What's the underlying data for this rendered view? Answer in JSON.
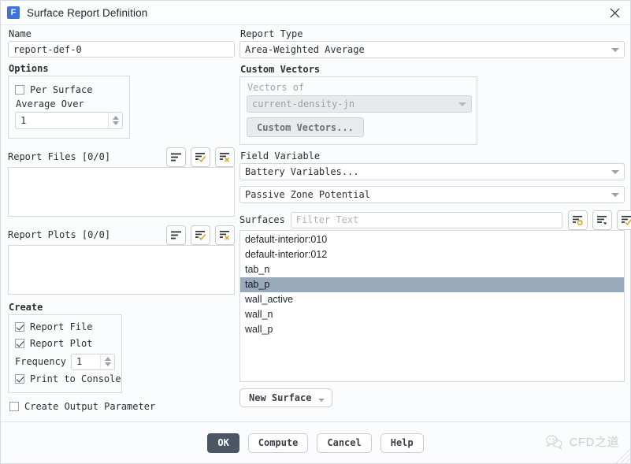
{
  "window": {
    "title": "Surface Report Definition",
    "app_icon_letter": "F",
    "close_icon": "close-icon"
  },
  "left": {
    "name_label": "Name",
    "name_value": "report-def-0",
    "options_label": "Options",
    "per_surface_label": "Per Surface",
    "per_surface_checked": false,
    "average_over_label": "Average Over",
    "average_over_value": "1",
    "report_files_label": "Report Files [0/0]",
    "report_plots_label": "Report Plots [0/0]",
    "files_icons": [
      "list-icon",
      "list-check-icon",
      "list-delete-icon"
    ],
    "plots_icons": [
      "list-icon",
      "list-check-icon",
      "list-delete-icon"
    ],
    "files_items": [],
    "plots_items": [],
    "create_label": "Create",
    "report_file_label": "Report File",
    "report_file_checked": true,
    "report_plot_label": "Report Plot",
    "report_plot_checked": true,
    "frequency_label": "Frequency",
    "frequency_value": "1",
    "print_to_console_label": "Print to Console",
    "print_to_console_checked": true,
    "create_output_parameter_label": "Create Output Parameter",
    "create_output_parameter_checked": false
  },
  "right": {
    "report_type_label": "Report Type",
    "report_type_value": "Area-Weighted Average",
    "custom_vectors_label": "Custom Vectors",
    "vectors_of_label": "Vectors of",
    "vectors_of_value": "current-density-jn",
    "custom_vectors_button": "Custom Vectors...",
    "field_variable_label": "Field Variable",
    "field_variable_category": "Battery Variables...",
    "field_variable_value": "Passive Zone Potential",
    "surfaces_label": "Surfaces",
    "surfaces_filter_placeholder": "Filter Text",
    "surfaces_filter_value": "",
    "surface_icons": [
      "list-select-icon",
      "list-dropdown-icon",
      "list-check-icon",
      "list-delete-icon"
    ],
    "surfaces": [
      {
        "label": "default-interior:010",
        "selected": false
      },
      {
        "label": "default-interior:012",
        "selected": false
      },
      {
        "label": "tab_n",
        "selected": false
      },
      {
        "label": "tab_p",
        "selected": true
      },
      {
        "label": "wall_active",
        "selected": false
      },
      {
        "label": "wall_n",
        "selected": false
      },
      {
        "label": "wall_p",
        "selected": false
      }
    ],
    "new_surface_button": "New Surface"
  },
  "footer": {
    "ok_label": "OK",
    "compute_label": "Compute",
    "cancel_label": "Cancel",
    "help_label": "Help"
  },
  "watermark": {
    "text": "CFD之道",
    "icon": "wechat-icon"
  },
  "colors": {
    "accent_blue": "#3e73dd",
    "selection": "#9aaabd",
    "primary_button": "#4d5664",
    "icon_gold": "#d8a62a"
  }
}
